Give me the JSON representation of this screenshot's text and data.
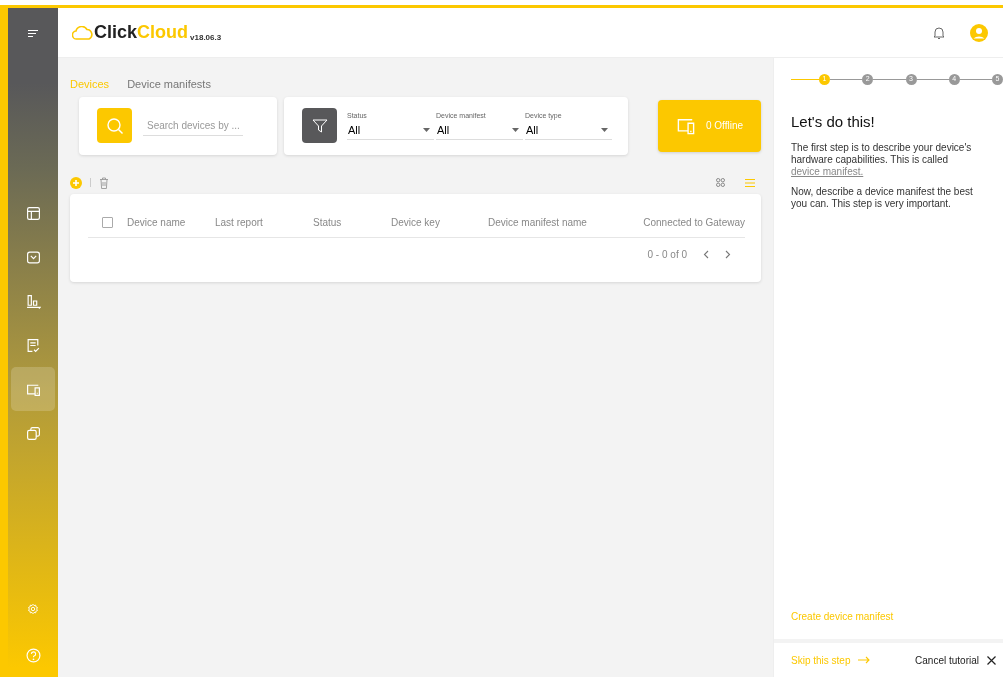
{
  "brand": {
    "first": "Click",
    "second": "Cloud",
    "version": "v18.06.3"
  },
  "sidebar": {
    "items": [
      {
        "kind": "layout",
        "selected": false
      },
      {
        "kind": "inbox",
        "selected": false
      },
      {
        "kind": "chart",
        "selected": false
      },
      {
        "kind": "checklist",
        "selected": false
      },
      {
        "kind": "devices",
        "selected": true
      },
      {
        "kind": "copies",
        "selected": false
      }
    ],
    "bottom": [
      {
        "kind": "settings"
      },
      {
        "kind": "help"
      }
    ]
  },
  "tabs": [
    {
      "label": "Devices",
      "selected": true
    },
    {
      "label": "Device manifests",
      "selected": false
    }
  ],
  "search": {
    "placeholder": "Search devices by ..."
  },
  "filters": [
    {
      "label": "Status",
      "value": "All"
    },
    {
      "label": "Device manifest",
      "value": "All"
    },
    {
      "label": "Device type",
      "value": "All"
    }
  ],
  "offline_button": {
    "label": "0 Offline"
  },
  "views": [
    {
      "kind": "grid",
      "selected": false
    },
    {
      "kind": "list",
      "selected": true
    }
  ],
  "table": {
    "select_all": {
      "checked": false
    },
    "columns": [
      "Device name",
      "Last report",
      "Status",
      "Device key",
      "Device manifest name",
      "Connected to Gateway"
    ],
    "pagination": "0 - 0 of 0"
  },
  "tutorial": {
    "steps": [
      {
        "label": "1",
        "selected": true
      },
      {
        "label": "2",
        "selected": false
      },
      {
        "label": "3",
        "selected": false
      },
      {
        "label": "4",
        "selected": false
      },
      {
        "label": "5",
        "selected": false
      }
    ],
    "title": "Let's do this!",
    "paragraph_1": "The first step is to describe your device's hardware capabilities. This is called",
    "link": "device manifest.",
    "paragraph_2": "Now, describe a device manifest the best you can. This step is very important.",
    "action": "Create device manifest",
    "skip": "Skip this step",
    "cancel": "Cancel tutorial"
  }
}
